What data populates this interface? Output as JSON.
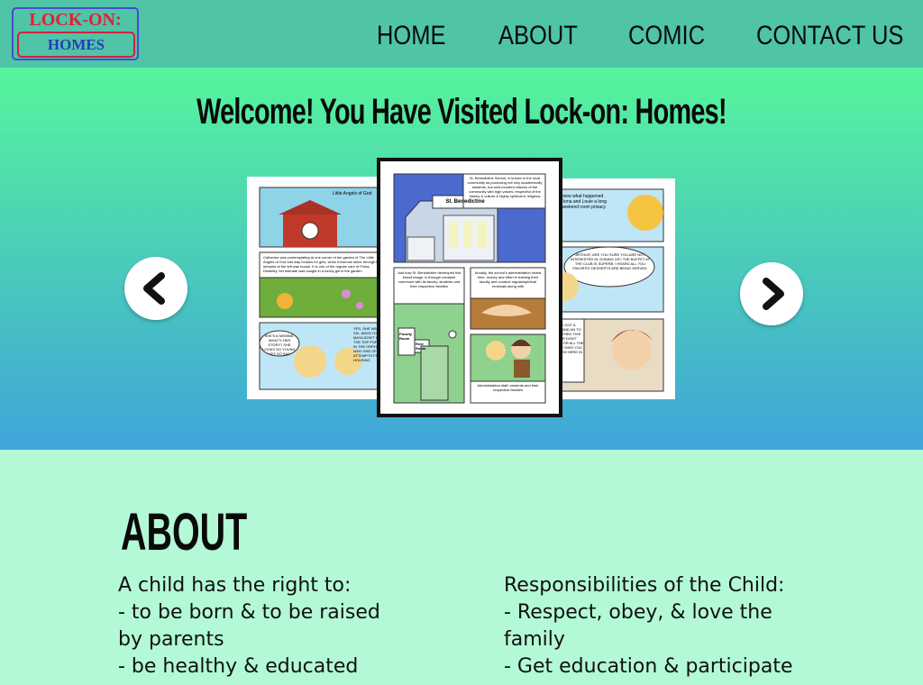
{
  "logo": {
    "line1": "LOCK-ON:",
    "line2": "HOMES"
  },
  "nav": {
    "home": "HOME",
    "about": "ABOUT",
    "comic": "COMIC",
    "contact": "CONTACT US"
  },
  "hero": {
    "title": "Welcome! You Have Visited Lock-on: Homes!"
  },
  "carousel": {
    "prev_icon": "chevron-left-icon",
    "next_icon": "chevron-right-icon",
    "center_page": {
      "caption_top": "St. Benedictine School, is known in the local community as producing not only academically students, but well-rounded citizens of the community with high values; respectful of the history & culture & highly spiritual & religious",
      "sign": "St. Benedictine",
      "caption_mid_left": "Just how St. Benedictine developed this brand image, is through constant commune with its faculty, students and their respective families",
      "caption_mid_right": "Anually, the school's administration invest time, money and effort in training their faculty and conduct regular/spiritual renewals along with",
      "room1": "Faculty Room",
      "room2": "Rest Room",
      "caption_bottom": "Administration staff, students and their respective families"
    },
    "left_page": {
      "caption_top": "Little Angels of God",
      "caption_mid": "Catherine was contemplating at one corner of the garden of The Little Angels of God told way houses for girls, when tomorrow shine through the streams of the left was house. It is one of the regular care of Fiona, Destinity, her intimate was caught in a lonely girl in the garden",
      "bubble1": "SHE'S A NEWBIE. WHAT'S HER STORY? SHE LOOKS SO YOUNG, YET SO SAD",
      "bubble2": "YES, SHE WAS JUST SIX. MAYA YOU MAYA DON'T KNOW? THE TOP POPULAR IN THE ORPHANAGE WHO SHE OF THE ATTEMPTS FROM HOUSING"
    },
    "right_page": {
      "caption_top": "knew what happened . Fiona and Louie a long weekend room privacy",
      "bubble1": "ARTHUR, ARE YOU SURE YOU ARE NOT INTERESTED IN JOINING US? THE BUFFET AT THE CLUB IS SUPERB. I HEARD ALL YOU FAVORITE DESSERTS ARE BEING SERVED.",
      "bubble2": "R, BUT I GOT A WORK AND AN TO DO AS THEN THIS ROTHER DON'T CARE FOR ALL THE I WON'T MISS YOU KNOW I'M HERE IN FOOD"
    }
  },
  "about": {
    "title": "ABOUT",
    "left": [
      "A child has the right to:",
      "- to be born & to be raised",
      "by parents",
      "- be healthy & educated"
    ],
    "right": [
      "Responsibilities of the Child:",
      "- Respect, obey, & love the",
      "family",
      "- Get education & participate"
    ]
  },
  "colors": {
    "nav_bg": "#4fc4a6",
    "hero_top": "#56f59c",
    "hero_bottom": "#3fa5da",
    "about_bg": "#b3f9d6"
  }
}
